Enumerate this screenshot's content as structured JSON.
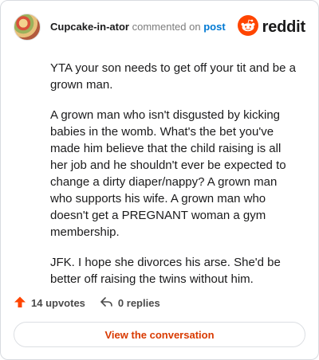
{
  "header": {
    "username": "Cupcake-in-ator",
    "action_text": "commented on",
    "post_link": "post",
    "brand_name": "reddit",
    "brand_color": "#ff4500"
  },
  "comment": {
    "paragraphs": [
      "YTA your son needs to get off your tit and be a grown man.",
      "A grown man who isn't disgusted by kicking babies in the womb. What's the bet you've made him believe that the child raising is all her job and he shouldn't ever be expected to change a dirty diaper/nappy? A grown man who supports his wife. A grown man who doesn't get a PREGNANT woman a gym membership.",
      "JFK. I hope she divorces his arse. She'd be better off raising the twins without him."
    ]
  },
  "actions": {
    "upvotes_label": "14 upvotes",
    "upvote_icon": "upvote-arrow-icon",
    "upvote_color": "#ff4500",
    "replies_label": "0 replies",
    "reply_icon": "reply-arrow-icon"
  },
  "cta": {
    "label": "View the conversation",
    "color": "#d93a00"
  }
}
